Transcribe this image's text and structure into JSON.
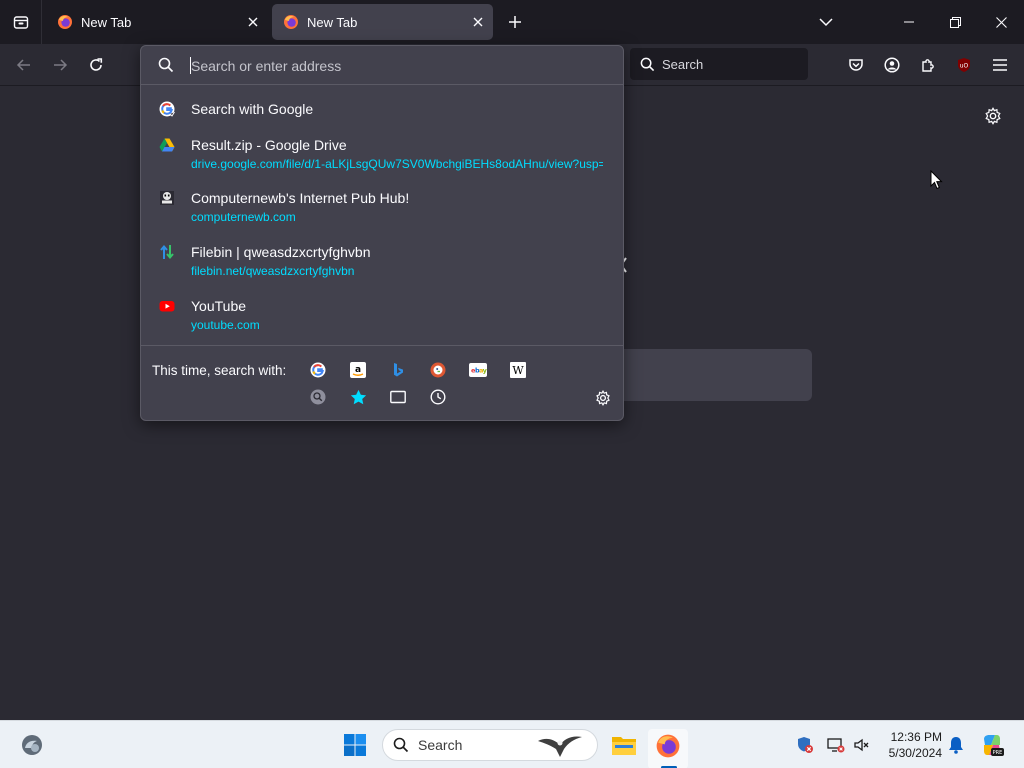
{
  "tabs": [
    {
      "title": "New Tab",
      "active": false
    },
    {
      "title": "New Tab",
      "active": true
    }
  ],
  "toolbar": {
    "search_placeholder": "Search"
  },
  "urlbar": {
    "placeholder": "Search or enter address",
    "results": [
      {
        "title": "Search with Google",
        "url": "",
        "icon": "google-search-icon"
      },
      {
        "title": "Result.zip - Google Drive",
        "url": "drive.google.com/file/d/1-aLKjLsgQUw7SV0WbchgiBEHs8odAHnu/view?usp=",
        "icon": "google-drive-icon"
      },
      {
        "title": "Computernewb's Internet Pub Hub!",
        "url": "computernewb.com",
        "icon": "computernewb-icon"
      },
      {
        "title": "Filebin | qweasdzxcrtyfghvbn",
        "url": "filebin.net/qweasdzxcrtyfghvbn",
        "icon": "filebin-icon"
      },
      {
        "title": "YouTube",
        "url": "youtube.com",
        "icon": "youtube-icon"
      }
    ],
    "oneoff_label": "This time, search with:",
    "oneoff_engines": [
      "google-icon",
      "amazon-icon",
      "bing-icon",
      "duckduckgo-icon",
      "ebay-icon",
      "wikipedia-icon"
    ],
    "oneoff_modes": [
      "search-tabs-icon",
      "bookmarks-star-icon",
      "tabs-icon",
      "history-clock-icon"
    ]
  },
  "taskbar": {
    "search_label": "Search",
    "time": "12:36 PM",
    "date": "5/30/2024"
  },
  "colors": {
    "tabstrip_bg": "#1c1b22",
    "toolbar_bg": "#2b2a33",
    "popup_bg": "#42414d",
    "url_accent": "#00ddff",
    "taskbar_bg": "#ecf1f6"
  }
}
